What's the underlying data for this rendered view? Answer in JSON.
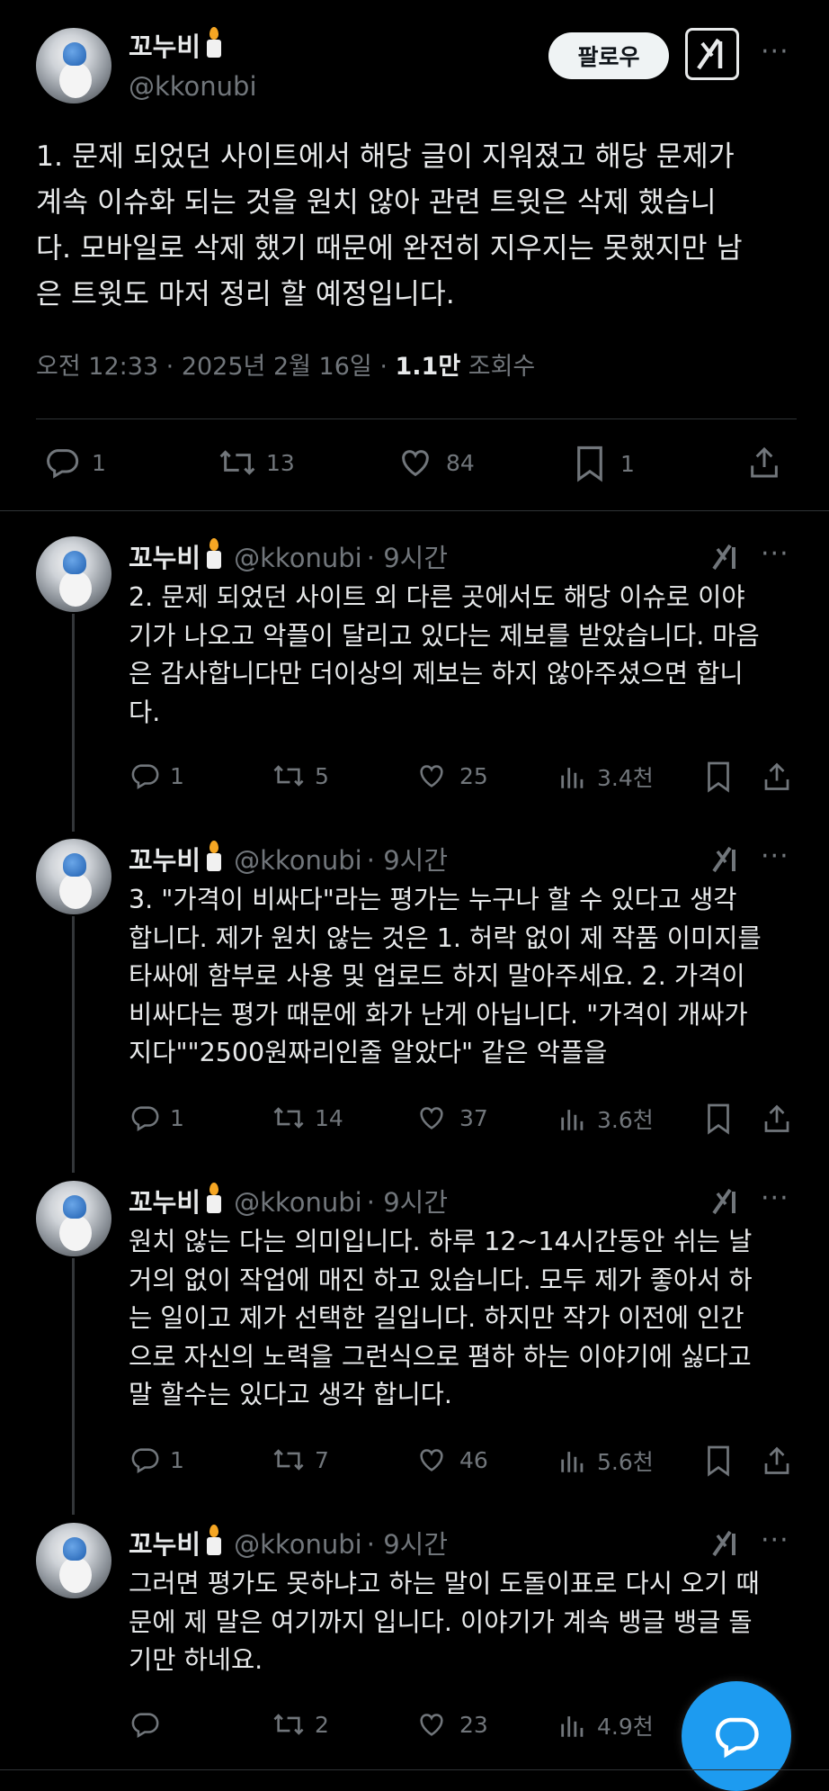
{
  "main_tweet": {
    "author_name": "꼬누비",
    "author_handle": "@kkonubi",
    "follow_label": "팔로우",
    "text_lines": [
      "1. 문제 되었던 사이트에서 해당 글이 지워졌고 해당 문제가",
      "계속 이슈화 되는 것을 원치 않아 관련 트윗은 삭제 했습니",
      "다. 모바일로 삭제 했기 때문에 완전히 지우지는 못했지만 남",
      "은 트윗도 마저 정리 할 예정입니다."
    ],
    "timestamp": "오전 12:33 · 2025년 2월 16일 · ",
    "views_count": "1.1만",
    "views_label": " 조회수",
    "stats": {
      "replies": "1",
      "reposts": "13",
      "likes": "84",
      "bookmarks": "1"
    }
  },
  "replies": [
    {
      "author_name": "꼬누비",
      "author_handle": "@kkonubi",
      "time": "· 9시간",
      "text_lines": [
        "2. 문제 되었던 사이트 외 다른 곳에서도 해당 이슈로 이야",
        "기가 나오고 악플이 달리고 있다는 제보를 받았습니다. 마음",
        "은 감사합니다만 더이상의 제보는 하지 않아주셨으면 합니",
        "다."
      ],
      "stats": {
        "replies": "1",
        "reposts": "5",
        "likes": "25",
        "views": "3.4천"
      }
    },
    {
      "author_name": "꼬누비",
      "author_handle": "@kkonubi",
      "time": "· 9시간",
      "text_lines": [
        "3. \"가격이 비싸다\"라는 평가는 누구나 할 수 있다고 생각",
        "합니다. 제가 원치 않는 것은 1. 허락 없이 제 작품 이미지를",
        "타싸에 함부로 사용 및 업로드 하지 말아주세요. 2. 가격이",
        "비싸다는 평가 때문에 화가 난게 아닙니다. \"가격이 개싸가",
        "지다\"\"2500원짜리인줄 알았다\" 같은 악플을"
      ],
      "stats": {
        "replies": "1",
        "reposts": "14",
        "likes": "37",
        "views": "3.6천"
      }
    },
    {
      "author_name": "꼬누비",
      "author_handle": "@kkonubi",
      "time": "· 9시간",
      "text_lines": [
        "원치 않는 다는 의미입니다. 하루 12~14시간동안 쉬는 날",
        "거의 없이 작업에 매진 하고 있습니다. 모두 제가 좋아서 하",
        "는 일이고 제가 선택한 길입니다. 하지만 작가 이전에 인간",
        "으로 자신의 노력을 그런식으로 폄하 하는 이야기에 싫다고",
        "말 할수는 있다고 생각 합니다."
      ],
      "stats": {
        "replies": "1",
        "reposts": "7",
        "likes": "46",
        "views": "5.6천"
      }
    },
    {
      "author_name": "꼬누비",
      "author_handle": "@kkonubi",
      "time": "· 9시간",
      "text_lines": [
        "그러면 평가도 못하냐고 하는 말이 도돌이표로 다시 오기 때",
        "문에 제 말은 여기까지 입니다. 이야기가 계속 뱅글 뱅글 돌",
        "기만 하네요."
      ],
      "stats": {
        "replies": "",
        "reposts": "2",
        "likes": "23",
        "views": "4.9천"
      }
    }
  ],
  "colors": {
    "background": "#000000",
    "text": "#e7e9ea",
    "muted": "#71767b",
    "accent": "#1d9bf0",
    "divider": "#2f3336"
  },
  "icons": [
    "grok-icon",
    "more-icon",
    "reply-icon",
    "repost-icon",
    "like-icon",
    "views-icon",
    "bookmark-icon",
    "share-icon",
    "compose-icon"
  ]
}
